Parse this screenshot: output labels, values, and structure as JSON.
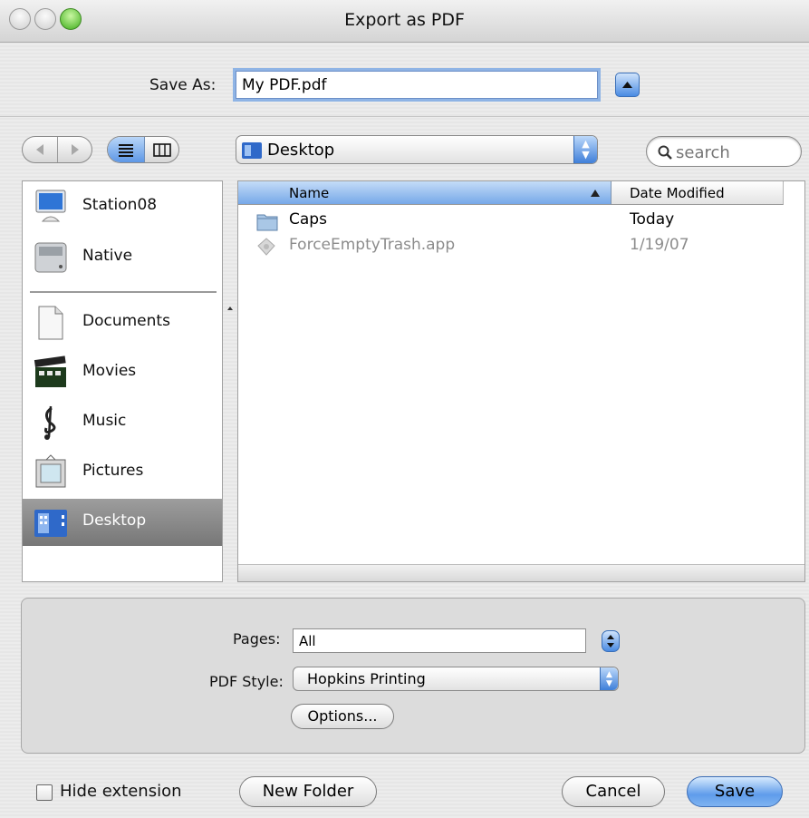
{
  "window": {
    "title": "Export as PDF"
  },
  "save_as": {
    "label": "Save As:",
    "value": "My PDF.pdf"
  },
  "toolbar": {
    "location": "Desktop",
    "search_placeholder": "search"
  },
  "sidebar": {
    "devices": [
      {
        "label": "Station08",
        "icon": "computer-icon"
      },
      {
        "label": "Native",
        "icon": "hard-drive-icon"
      }
    ],
    "places": [
      {
        "label": "Documents",
        "icon": "document-icon"
      },
      {
        "label": "Movies",
        "icon": "clapperboard-icon"
      },
      {
        "label": "Music",
        "icon": "music-note-icon"
      },
      {
        "label": "Pictures",
        "icon": "picture-frame-icon"
      },
      {
        "label": "Desktop",
        "icon": "desktop-folder-icon",
        "selected": true
      }
    ]
  },
  "file_list": {
    "columns": {
      "name": "Name",
      "date": "Date Modified"
    },
    "rows": [
      {
        "name": "Caps",
        "date": "Today",
        "icon": "folder-icon",
        "enabled": true
      },
      {
        "name": "ForceEmptyTrash.app",
        "date": "1/19/07",
        "icon": "application-icon",
        "enabled": false
      }
    ]
  },
  "options": {
    "pages_label": "Pages:",
    "pages_value": "All",
    "style_label": "PDF Style:",
    "style_value": "Hopkins Printing",
    "options_button": "Options..."
  },
  "footer": {
    "hide_extension": "Hide extension",
    "new_folder": "New Folder",
    "cancel": "Cancel",
    "save": "Save"
  },
  "colors": {
    "accent": "#5f9ceb",
    "selection": "#888888"
  }
}
